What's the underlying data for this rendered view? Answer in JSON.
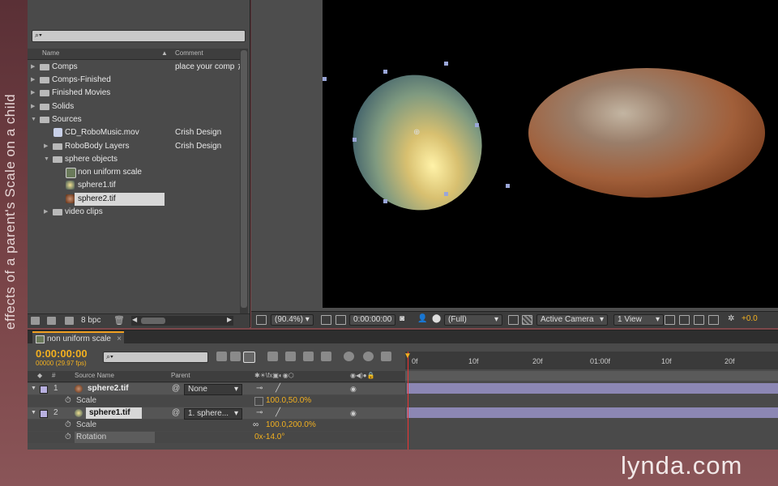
{
  "caption": "effects of a parent's Scale on a child",
  "project": {
    "columns": {
      "name": "Name",
      "comment": "Comment"
    },
    "items": [
      {
        "label": "Comps",
        "comment": "place your comp",
        "type": "folder",
        "indent": 0
      },
      {
        "label": "Comps-Finished",
        "comment": "",
        "type": "folder",
        "indent": 0
      },
      {
        "label": "Finished Movies",
        "comment": "",
        "type": "folder",
        "indent": 0
      },
      {
        "label": "Solids",
        "comment": "",
        "type": "folder",
        "indent": 0
      },
      {
        "label": "Sources",
        "comment": "",
        "type": "folder-open",
        "indent": 0
      },
      {
        "label": "CD_RoboMusic.mov",
        "comment": "Crish Design",
        "type": "file",
        "indent": 1
      },
      {
        "label": "RoboBody Layers",
        "comment": "Crish Design",
        "type": "folder",
        "indent": 1
      },
      {
        "label": "sphere objects",
        "comment": "",
        "type": "folder-open",
        "indent": 1
      },
      {
        "label": "non uniform scale",
        "comment": "",
        "type": "comp",
        "indent": 2
      },
      {
        "label": "sphere1.tif",
        "comment": "",
        "type": "file",
        "indent": 2
      },
      {
        "label": "sphere2.tif",
        "comment": "",
        "type": "file",
        "indent": 2,
        "selected": true
      },
      {
        "label": "video clips",
        "comment": "",
        "type": "folder",
        "indent": 1
      }
    ],
    "footer_bpc": "8 bpc"
  },
  "viewer": {
    "zoom": "(90.4%)",
    "timecode": "0:00:00:00",
    "resolution": "(Full)",
    "camera": "Active Camera",
    "views": "1 View",
    "offset": "+0.0"
  },
  "timeline": {
    "tab": "non uniform scale",
    "timecode": "0:00:00:00",
    "fps": "00000 (29.97 fps)",
    "header": {
      "num": "#",
      "source": "Source Name",
      "parent": "Parent"
    },
    "ruler": [
      "0f",
      "10f",
      "20f",
      "01:00f",
      "10f",
      "20f"
    ],
    "layers": [
      {
        "index": "1",
        "name": "sphere2.tif",
        "parent": "None",
        "prop_name": "Scale",
        "prop_value": "100.0,50.0%"
      },
      {
        "index": "2",
        "name": "sphere1.tif",
        "parent": "1. sphere...",
        "prop_name": "Scale",
        "prop_value": "100.0,200.0%",
        "prop2_name": "Rotation",
        "prop2_value": "0x-14.0°"
      }
    ]
  },
  "watermark": "lynda.com"
}
